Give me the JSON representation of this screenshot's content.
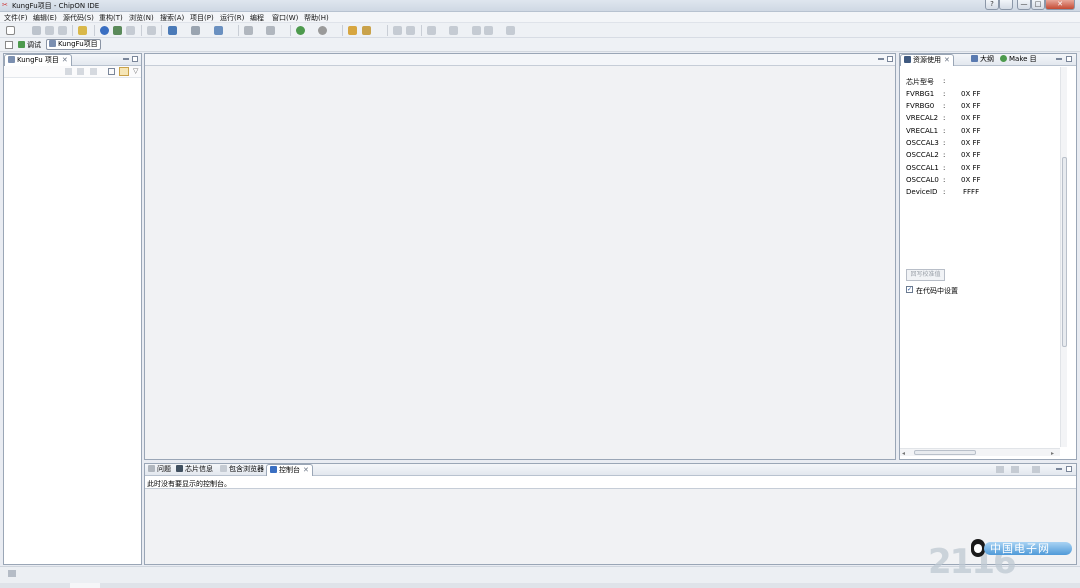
{
  "window": {
    "title": "KungFu项目 - ChipON IDE",
    "controls": [
      "?",
      "—",
      "□",
      "✕"
    ]
  },
  "menu": [
    "文件(F)",
    "编辑(E)",
    "源代码(S)",
    "重构(T)",
    "浏览(N)",
    "搜索(A)",
    "项目(P)",
    "运行(R)",
    "编程",
    "窗口(W)",
    "帮助(H)"
  ],
  "perspectives": {
    "debug_label": "调试",
    "kungfu_label": "KungFu项目"
  },
  "project_view": {
    "tab_label": "KungFu 项目"
  },
  "outline": {
    "tabs": {
      "resources": "资源使用",
      "outline": "大纲",
      "make": "Make 目"
    },
    "chip_label": "芯片型号",
    "chip_colon": ":",
    "registers": [
      {
        "name": "FVRBG1",
        "colon": ":",
        "value": "0X FF"
      },
      {
        "name": "FVRBG0",
        "colon": ":",
        "value": "0X FF"
      },
      {
        "name": "VRECAL2",
        "colon": ":",
        "value": "0X FF"
      },
      {
        "name": "VRECAL1",
        "colon": ":",
        "value": "0X FF"
      },
      {
        "name": "OSCCAL3",
        "colon": ":",
        "value": "0X FF"
      },
      {
        "name": "OSCCAL2",
        "colon": ":",
        "value": "0X FF"
      },
      {
        "name": "OSCCAL1",
        "colon": ":",
        "value": "0X FF"
      },
      {
        "name": "OSCCAL0",
        "colon": ":",
        "value": "0X FF"
      },
      {
        "name": "DeviceID",
        "colon": ":",
        "value": "FFFF"
      }
    ],
    "calibrate_button": "回写校准值",
    "set_in_code_label": "在代码中设置",
    "set_in_code_checked": true
  },
  "bottom": {
    "tabs": {
      "problems": "问题",
      "chip_info": "芯片信息",
      "include_browser": "包含浏览器",
      "console": "控制台"
    },
    "console_message": "此时没有要显示的控制台。"
  },
  "watermark": {
    "text": "中国电子网",
    "number": "2116"
  }
}
